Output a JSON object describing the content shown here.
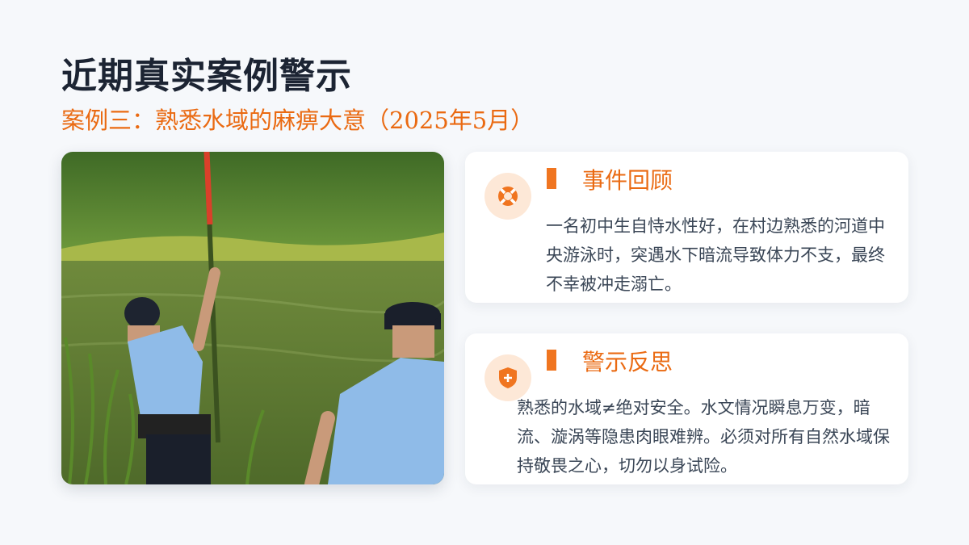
{
  "title": "近期真实案例警示",
  "subtitle": "案例三：熟悉水域的麻痹大意（2025年5月）",
  "photo": {
    "description_icon": "photo"
  },
  "cards": [
    {
      "icon": "lifebuoy-icon",
      "heading": "事件回顾",
      "body": "一名初中生自恃水性好，在村边熟悉的河道中央游泳时，突遇水下暗流导致体力不支，最终不幸被冲走溺亡。"
    },
    {
      "icon": "shield-plus-icon",
      "heading": "警示反思",
      "body": "熟悉的水域≠绝对安全。水文情况瞬息万变，暗流、漩涡等隐患肉眼难辨。必须对所有自然水域保持敬畏之心，切勿以身试险。"
    }
  ],
  "colors": {
    "accent": "#ea6a12",
    "background": "#f6f8fb",
    "title": "#1c2433"
  }
}
